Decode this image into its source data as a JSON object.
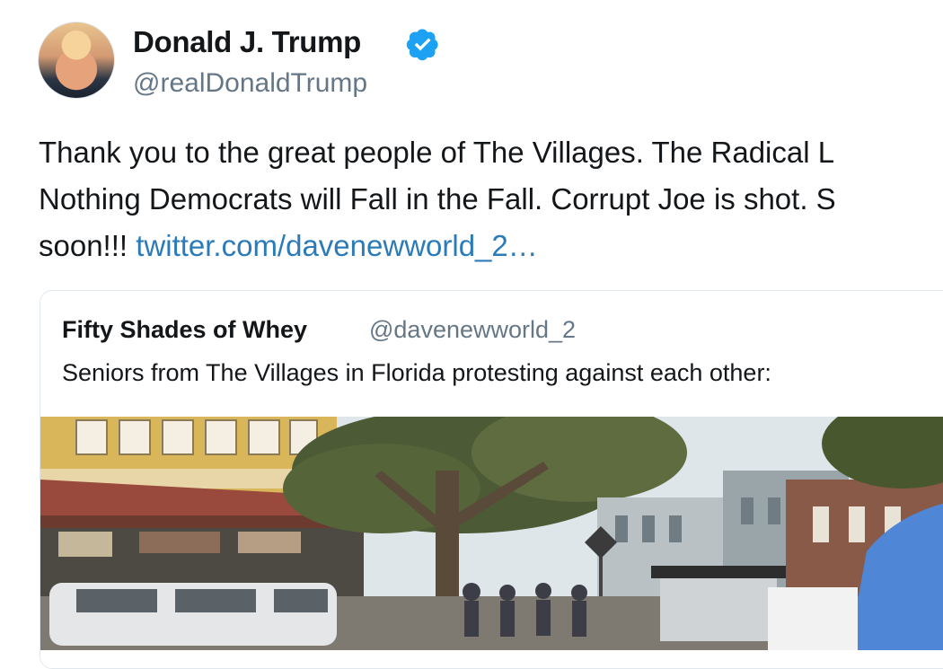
{
  "tweet": {
    "author_name": "Donald J. Trump",
    "author_handle": "@realDonaldTrump",
    "text_line_1": "Thank you to the great people of The Villages. The Radical L",
    "text_line_2": "Nothing Democrats will Fall in the Fall. Corrupt Joe is shot. S",
    "text_line_3_prefix": "soon!!! ",
    "link_text": "twitter.com/davenewworld_2…"
  },
  "quoted_tweet": {
    "author_name": "Fifty Shades of Whey",
    "author_handle": "@davenewworld_2",
    "text": "Seniors from The Villages in Florida protesting against each other:"
  },
  "colors": {
    "verified": "#1da1f2",
    "link": "#2b7bb9",
    "handle": "#657786"
  },
  "icons": {
    "verified": "verified-badge-icon",
    "avatar": "profile-avatar"
  }
}
